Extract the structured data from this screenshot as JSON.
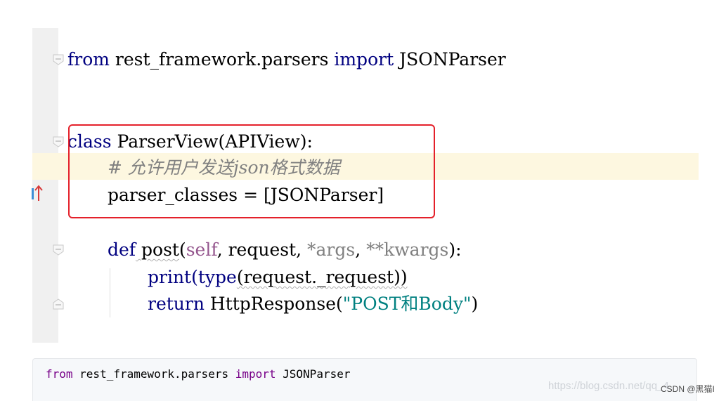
{
  "editor": {
    "line1": {
      "kw_from": "from",
      "module": " rest_framework.parsers ",
      "kw_import": "import",
      "name": " JSONParser"
    },
    "line2": {
      "kw_class": "class",
      "name": " ParserView(APIView):"
    },
    "line3": {
      "comment": "# 允许用户发送json格式数据"
    },
    "line4": {
      "text": "parser_classes = [JSONParser]"
    },
    "line5": {
      "kw_def": "def",
      "fname": " post",
      "open": "(",
      "self": "self",
      "sep1": ", request, ",
      "args": "*args",
      "sep2": ", ",
      "kwargs": "**kwargs",
      "close": "):"
    },
    "line6": {
      "print": "print",
      "open": "(",
      "type": "type",
      "rest": "(request._request))"
    },
    "line7": {
      "kw_return": "return",
      "call": " HttpResponse(",
      "string": "\"POST和Body\"",
      "close": ")"
    }
  },
  "snippet": {
    "kw_from": "from",
    "module": " rest_framework.parsers ",
    "kw_import": "import",
    "name": " JSONParser"
  },
  "watermark": {
    "url": "https://blog.csdn.net/qq_4",
    "csdn": "CSDN @黑猫I"
  },
  "colors": {
    "keyword": "#000080",
    "string": "#008080",
    "comment": "#808080",
    "highlight_border": "#e4202a",
    "caret_line": "#fdf7e0"
  },
  "icons": [
    "fold-open-icon",
    "fold-end-icon",
    "override-arrow-icon"
  ]
}
